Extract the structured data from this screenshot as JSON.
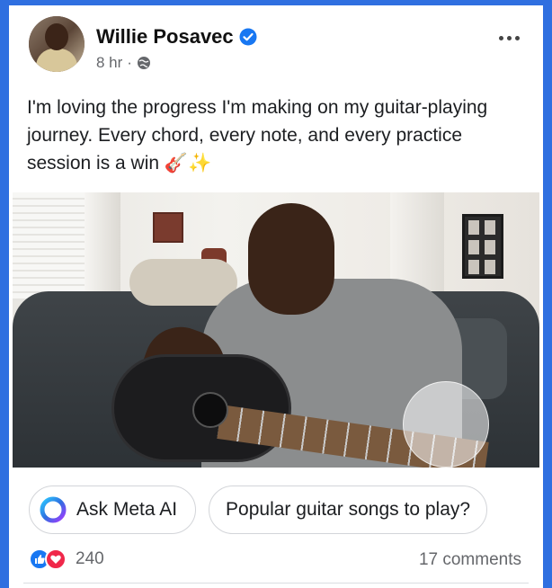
{
  "post": {
    "author_name": "Willie Posavec",
    "time": "8 hr",
    "separator": "·",
    "text": "I'm loving the progress I'm making on my guitar-playing journey. Every chord, every note, and every practice session is a win 🎸✨",
    "audience_icon": "globe-icon",
    "more_icon": "more-options-icon"
  },
  "chips": [
    {
      "label": "Ask Meta AI",
      "icon": "meta-ai-icon"
    },
    {
      "label": "Popular guitar songs to play?"
    }
  ],
  "reactions": {
    "count": "240",
    "comments": "17 comments",
    "icons": [
      "like-icon",
      "love-icon"
    ]
  },
  "colors": {
    "accent": "#2f6fe0",
    "verified": "#1877f2",
    "like": "#1877f2",
    "love": "#f0284a",
    "muted_text": "#65676b"
  }
}
